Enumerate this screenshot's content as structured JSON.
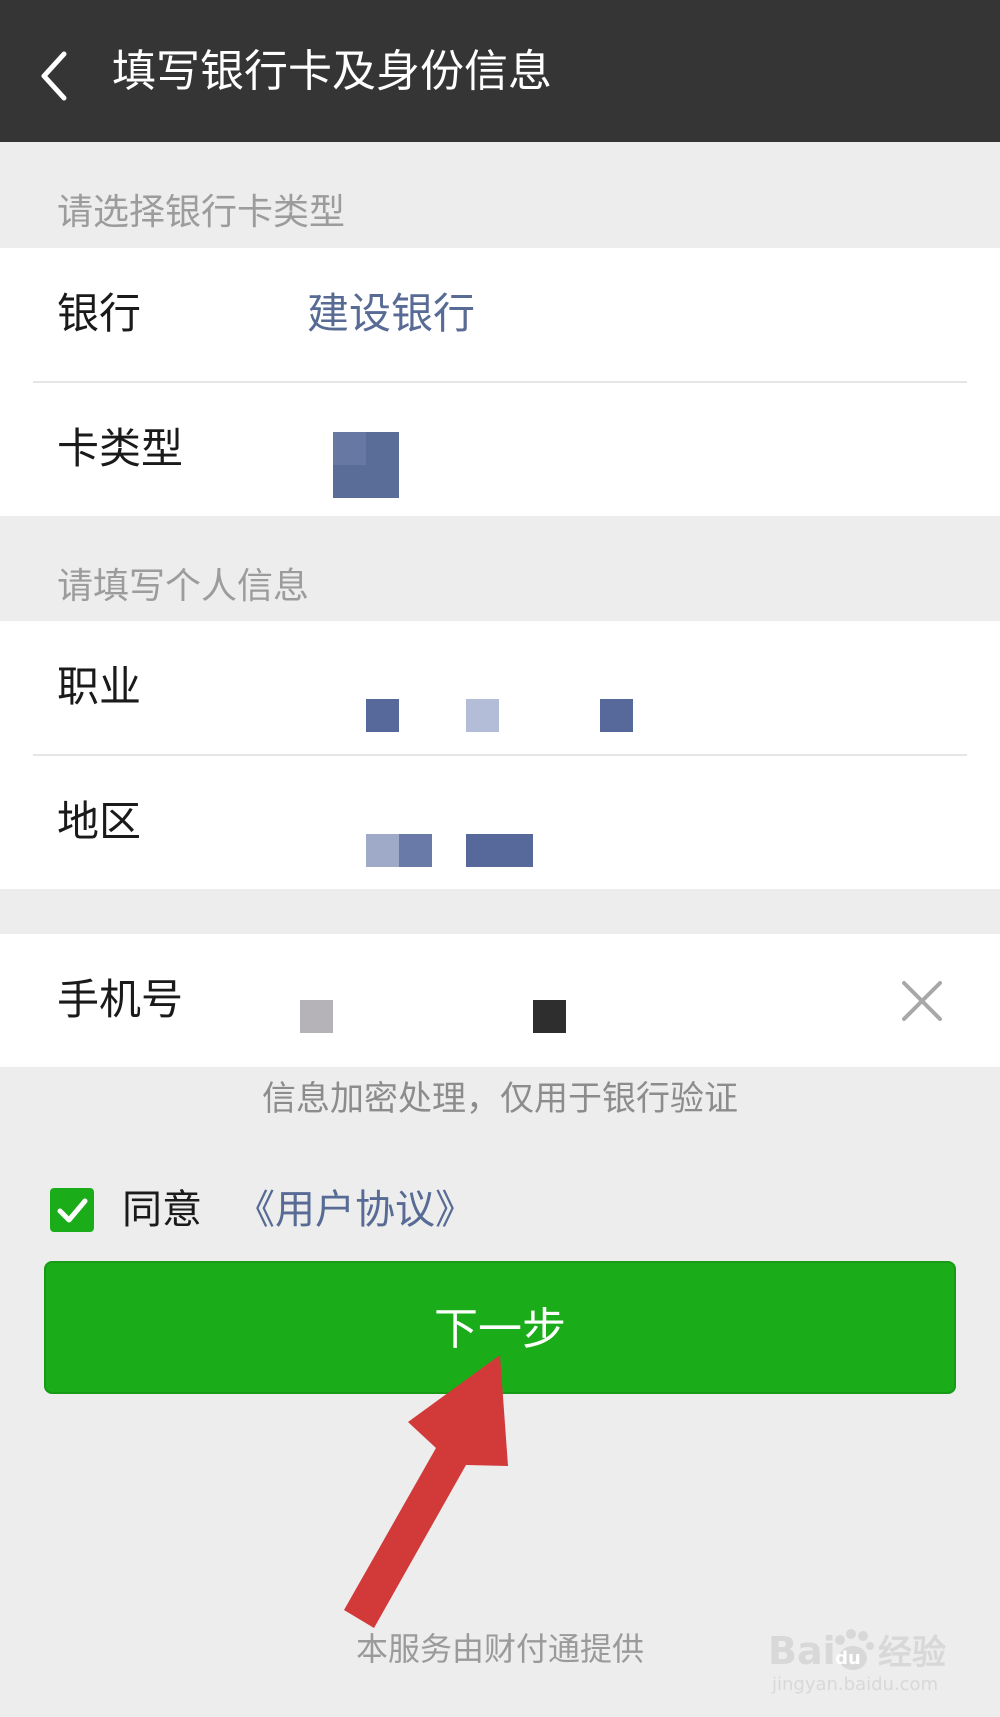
{
  "header": {
    "title": "填写银行卡及身份信息",
    "back_icon": "chevron-left-icon"
  },
  "bank_section": {
    "label": "请选择银行卡类型",
    "rows": [
      {
        "label": "银行",
        "value": "建设银行"
      },
      {
        "label": "卡类型",
        "value": ""
      }
    ]
  },
  "personal_section": {
    "label": "请填写个人信息",
    "rows": [
      {
        "label": "职业",
        "value": ""
      },
      {
        "label": "地区",
        "value": ""
      }
    ]
  },
  "phone": {
    "label": "手机号",
    "value": "",
    "clear_icon": "close-icon"
  },
  "hint": "信息加密处理，仅用于银行验证",
  "agreement": {
    "checked": true,
    "prefix": "同意",
    "link": "《用户协议》"
  },
  "next_button": "下一步",
  "footer": "本服务由财付通提供",
  "watermark": {
    "brand_left": "Bai",
    "brand_right": "经验",
    "url": "jingyan.baidu.com"
  },
  "colors": {
    "header_bg": "#353535",
    "page_bg": "#ededed",
    "link_blue": "#576b95",
    "primary_green": "#1aad19",
    "annotation_red": "#d23a3a"
  }
}
